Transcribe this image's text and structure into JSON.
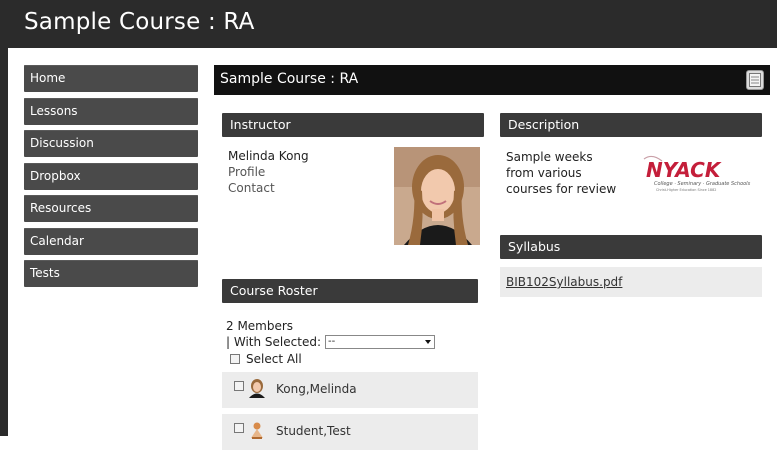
{
  "header": {
    "title": "Sample Course : RA"
  },
  "sidebar": {
    "items": [
      {
        "label": "Home"
      },
      {
        "label": "Lessons"
      },
      {
        "label": "Discussion"
      },
      {
        "label": "Dropbox"
      },
      {
        "label": "Resources"
      },
      {
        "label": "Calendar"
      },
      {
        "label": "Tests"
      }
    ]
  },
  "main": {
    "title": "Sample Course : RA",
    "instructor": {
      "heading": "Instructor",
      "name": "Melinda Kong",
      "profile_label": "Profile",
      "contact_label": "Contact"
    },
    "description": {
      "heading": "Description",
      "text": "Sample weeks from various courses for review",
      "logo_text": "NYACK",
      "logo_subtext": "College · Seminary · Graduate Schools",
      "logo_tagline": "Christ-Higher Education Since 1882"
    },
    "syllabus": {
      "heading": "Syllabus",
      "file": "BIB102Syllabus.pdf"
    },
    "roster": {
      "heading": "Course Roster",
      "count": "2 Members",
      "with_selected_label": "| With Selected:",
      "with_selected_value": "--",
      "select_all_label": "Select All",
      "members": [
        {
          "name": "Kong,Melinda"
        },
        {
          "name": "Student,Test"
        }
      ]
    }
  },
  "colors": {
    "header_bg": "#2b2b2b",
    "nav_bg": "#4a4a4a",
    "panel_head_bg": "#3a3a3a",
    "logo_red": "#c41e3a"
  }
}
